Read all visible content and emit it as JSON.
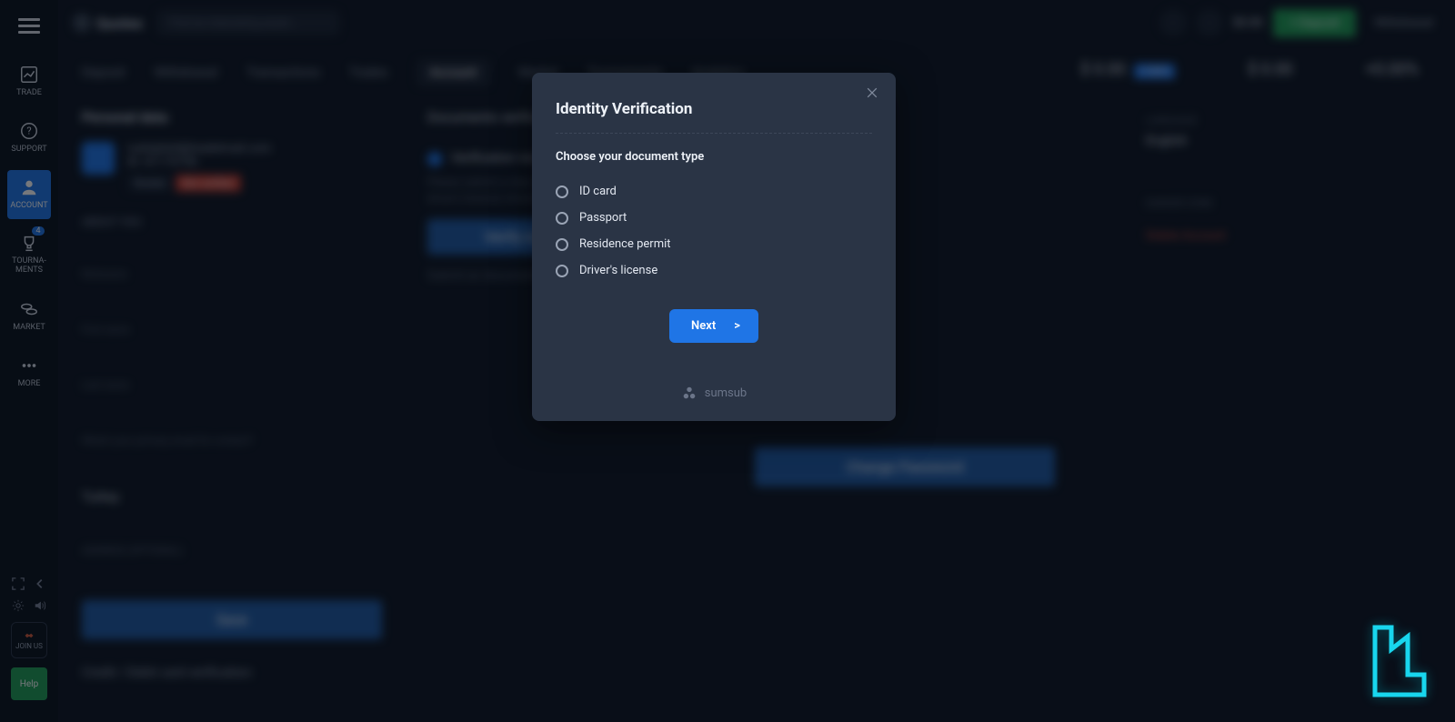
{
  "brand": "Quotex",
  "search_placeholder": "Find an interesting asset...",
  "sidebar": {
    "items": [
      {
        "label": "TRADE"
      },
      {
        "label": "SUPPORT"
      },
      {
        "label": "ACCOUNT"
      },
      {
        "label": "TOURNA-\nMENTS",
        "badge": "4"
      },
      {
        "label": "MARKET"
      },
      {
        "label": "MORE"
      }
    ],
    "joinus": "JOIN US",
    "help": "Help"
  },
  "header": {
    "balance": "$0.00",
    "deposit": "+ Deposit",
    "withdraw": "Withdrawal"
  },
  "tabs": [
    "Deposit",
    "Withdrawal",
    "Transactions",
    "Trades",
    "Account",
    "Market",
    "Tournaments",
    "Analytics"
  ],
  "active_tab": "Account",
  "stats": {
    "first_value": "$ 0.00",
    "first_pct": "+100%",
    "second_value": "$ 0.00",
    "second_pct": "+0%",
    "third_value": "+0.00%"
  },
  "personal": {
    "heading": "Personal data:",
    "email": "rudolph64@tradetmail.com",
    "id": "ID: 41175750",
    "level": "Rookie",
    "badge": "Not verified",
    "about_h": "ABOUT YOU",
    "nickname_label": "Nickname",
    "fname_label": "First name",
    "lname_label": "Last name",
    "dob_label": "Date of birth",
    "email_label": "What's your primary email for contact?",
    "country_label": "Country",
    "country_val": "Turkey",
    "addr_label": "ADDRESS (OPTIONAL)",
    "save": "Save"
  },
  "verif": {
    "heading": "Documents verification:",
    "step1": "Verification via the document",
    "para": "Please submit a clear photo of your document (passport, ID card or driver's license) showing your face.",
    "verify_btn": "Verify now",
    "step2": "Submit an documents",
    "passchg": "Change Password"
  },
  "right": {
    "lang_label": "LANGUAGE",
    "lang_val": "English",
    "dz_label": "DANGER ZONE",
    "dz_link": "Delete Account"
  },
  "credit_line": "Credit / Debit card verification:",
  "modal": {
    "title": "Identity Verification",
    "subtitle": "Choose your document type",
    "options": [
      "ID card",
      "Passport",
      "Residence permit",
      "Driver's license"
    ],
    "next": "Next",
    "provider": "sumsub"
  }
}
